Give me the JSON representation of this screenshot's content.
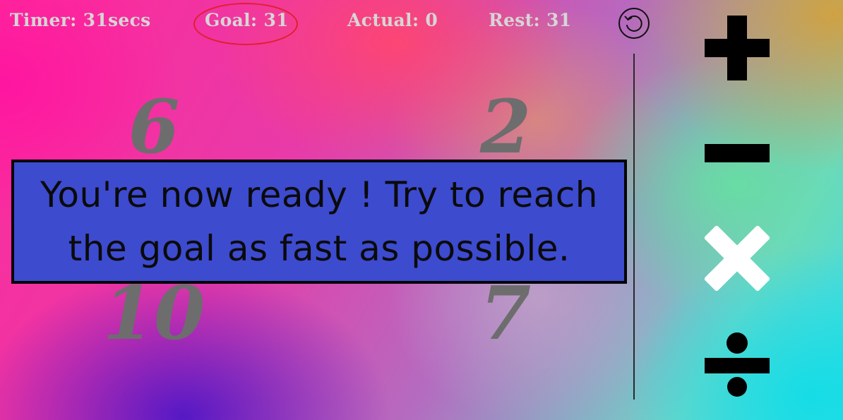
{
  "hud": {
    "timer": "Timer: 31secs",
    "goal": "Goal: 31",
    "actual": "Actual: 0",
    "rest": "Rest: 31"
  },
  "numbers": [
    "6",
    "2",
    "10",
    "7"
  ],
  "operators": [
    {
      "symbol": "+",
      "icon": "plus-icon",
      "color": "#000000"
    },
    {
      "symbol": "−",
      "icon": "minus-icon",
      "color": "#000000"
    },
    {
      "symbol": "×",
      "icon": "times-icon",
      "color": "#ffffff"
    },
    {
      "symbol": "÷",
      "icon": "divide-icon",
      "color": "#000000"
    }
  ],
  "message": {
    "line1": "You're now ready ! Try to reach",
    "line2": "the goal as fast as possible."
  },
  "colors": {
    "hud_text": "#d6d6d6",
    "goal_highlight": "#e0202e",
    "number_tile": "#6d6d6d",
    "message_background": "#3d4bcf",
    "message_border": "#050505"
  },
  "reset_icon": "reset-icon"
}
